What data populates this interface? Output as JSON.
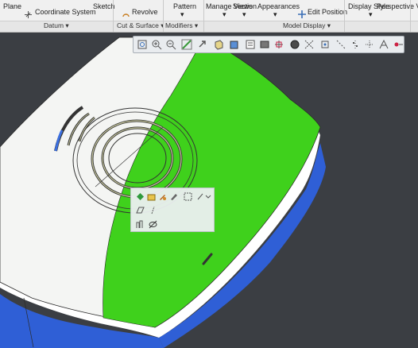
{
  "ribbon": {
    "datum": {
      "plane_label": "Plane",
      "coordinate_system_label": "Coordinate System",
      "sketch_label": "Sketch",
      "group_label": "Datum"
    },
    "cut_surface": {
      "revolve_label": "Revolve",
      "group_label": "Cut & Surface"
    },
    "modifiers": {
      "pattern_label": "Pattern",
      "group_label": "Modifiers"
    },
    "model_display": {
      "manage_views_label": "Manage Views",
      "section_label": "Section",
      "appearances_label": "Appearances",
      "edit_position_label": "Edit Position",
      "group_label": "Model Display"
    },
    "display_style_label": "Display Style",
    "perspective_view_label": "Perspective View",
    "dropdown_glyph": "▾"
  },
  "colors": {
    "canvas_bg": "#3b3e43",
    "model_white": "#f4f5f3",
    "model_green": "#3fd11c",
    "model_blue": "#2f5fd6"
  },
  "view_toolbar": {
    "buttons": [
      "refit-icon",
      "zoom-in-icon",
      "zoom-out-icon",
      "repaint-icon",
      "pan-icon",
      "saved-orientations-icon",
      "display-style-icon",
      "named-views-icon",
      "view-manager-icon",
      "section-icon",
      "appearance-icon",
      "datum-display-icon",
      "plane-display-icon",
      "axis-display-icon",
      "point-display-icon",
      "csys-display-icon",
      "annotation-display-icon",
      "spin-center-icon"
    ]
  },
  "mini_toolbar": {
    "buttons": [
      "hide-icon",
      "open-icon",
      "edit-definition-icon",
      "edit-icon",
      "insert-icon",
      "datum-plane-icon",
      "sketch-icon",
      "measure-icon",
      "visibility-icon"
    ]
  }
}
